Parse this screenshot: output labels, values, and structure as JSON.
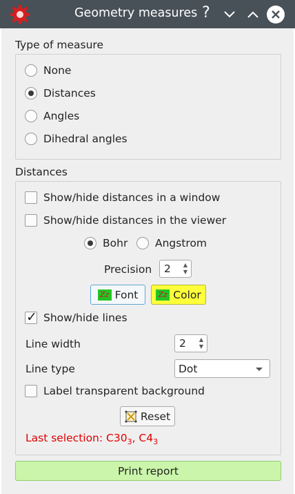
{
  "titlebar": {
    "title": "Geometry measures",
    "help_glyph": "?",
    "icons": [
      "app-icon",
      "help-icon",
      "minimize-icon",
      "maximize-icon",
      "close-icon"
    ]
  },
  "type_of_measure": {
    "label": "Type of measure",
    "options": [
      {
        "label": "None",
        "checked": false
      },
      {
        "label": "Distances",
        "checked": true
      },
      {
        "label": "Angles",
        "checked": false
      },
      {
        "label": "Dihedral angles",
        "checked": false
      }
    ]
  },
  "distances": {
    "label": "Distances",
    "show_window": {
      "label": "Show/hide distances in a window",
      "checked": false
    },
    "show_viewer": {
      "label": "Show/hide distances in the viewer",
      "checked": false
    },
    "units": [
      {
        "label": "Bohr",
        "checked": true
      },
      {
        "label": "Angstrom",
        "checked": false
      }
    ],
    "precision_label": "Precision",
    "precision_value": "2",
    "font_button": "Font",
    "color_button": "Color",
    "show_lines": {
      "label": "Show/hide lines",
      "checked": true
    },
    "line_width_label": "Line width",
    "line_width_value": "2",
    "line_type_label": "Line type",
    "line_type_value": "Dot",
    "transparent_bg": {
      "label": "Label transparent background",
      "checked": false
    },
    "reset_button": "Reset",
    "last_selection_prefix": "Last selection: C30",
    "last_selection_sub1": "3",
    "last_selection_mid": ", C4",
    "last_selection_sub2": "3"
  },
  "footer": {
    "print_report": "Print report"
  },
  "colors": {
    "titlebar": "#485058",
    "print_button": "#caf5aa",
    "color_button": "#ffff3a",
    "status_text": "#e00000"
  }
}
